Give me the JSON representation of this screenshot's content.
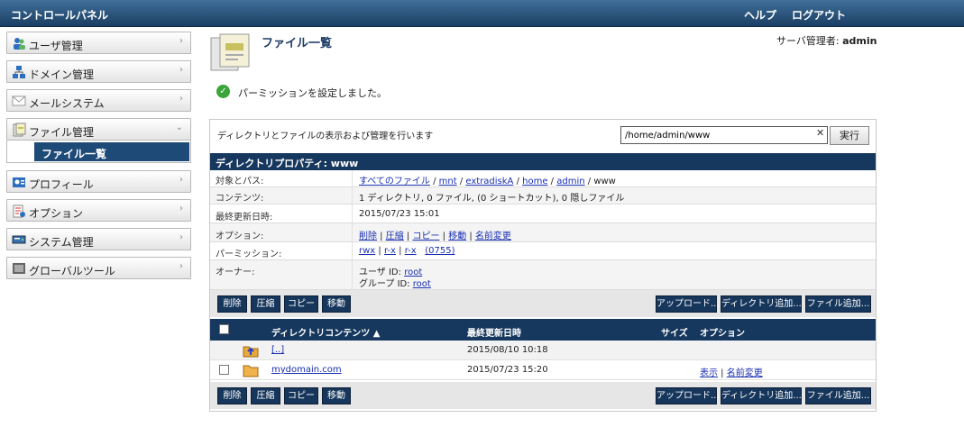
{
  "header": {
    "title": "コントロールパネル",
    "help": "ヘルプ",
    "logout": "ログアウト"
  },
  "sidebar": {
    "items": [
      {
        "label": "ユーザ管理",
        "icon": "users-icon"
      },
      {
        "label": "ドメイン管理",
        "icon": "network-icon"
      },
      {
        "label": "メールシステム",
        "icon": "mail-icon"
      },
      {
        "label": "ファイル管理",
        "icon": "files-icon",
        "expanded": true
      },
      {
        "label": "プロフィール",
        "icon": "profile-icon"
      },
      {
        "label": "オプション",
        "icon": "options-icon"
      },
      {
        "label": "システム管理",
        "icon": "server-icon"
      },
      {
        "label": "グローバルツール",
        "icon": "tools-icon"
      }
    ],
    "sub_item": "ファイル一覧"
  },
  "page": {
    "title": "ファイル一覧",
    "admin_prefix": "サーバ管理者: ",
    "admin_name": "admin",
    "success_message": "パーミッションを設定しました。"
  },
  "panel": {
    "description": "ディレクトリとファイルの表示および管理を行います",
    "path_value": "/home/admin/www",
    "clear": "✕",
    "exec": "実行",
    "props_title": "ディレクトリプロパティ: www"
  },
  "props": {
    "path": {
      "label": "対象とパス:",
      "links": [
        "すべてのファイル",
        "mnt",
        "extradiskA",
        "home",
        "admin"
      ],
      "sep": " / ",
      "current": "www"
    },
    "contents": {
      "label": "コンテンツ:",
      "value": "1 ディレクトリ, 0 ファイル, (0 ショートカット), 0 隠しファイル"
    },
    "modified": {
      "label": "最終更新日時:",
      "value": "2015/07/23 15:01"
    },
    "options": {
      "label": "オプション:",
      "links": [
        "削除",
        "圧縮",
        "コピー",
        "移動",
        "名前変更"
      ],
      "sep": " | "
    },
    "permission": {
      "label": "パーミッション:",
      "links": [
        "rwx",
        "r-x",
        "r-x"
      ],
      "sep": " | ",
      "octal": "(0755)"
    },
    "owner": {
      "label": "オーナー:",
      "user_prefix": "ユーザ ID: ",
      "user": "root",
      "group_prefix": "グループ ID: ",
      "group": "root"
    }
  },
  "toolbar": {
    "delete": "削除",
    "compress": "圧縮",
    "copy": "コピー",
    "move": "移動",
    "upload": "アップロード...",
    "add_dir": "ディレクトリ追加...",
    "add_file": "ファイル追加..."
  },
  "list": {
    "col_name": "ディレクトリコンテンツ",
    "sort_indicator": "▲",
    "col_modified": "最終更新日時",
    "col_size": "サイズ",
    "col_options": "オプション",
    "rows": [
      {
        "name": "[..]",
        "modified": "2015/08/10 10:18",
        "icon": "parent-folder-icon",
        "options": []
      },
      {
        "name": "mydomain.com",
        "modified": "2015/07/23 15:20",
        "icon": "folder-icon",
        "options": [
          "表示",
          "名前変更"
        ]
      }
    ]
  }
}
